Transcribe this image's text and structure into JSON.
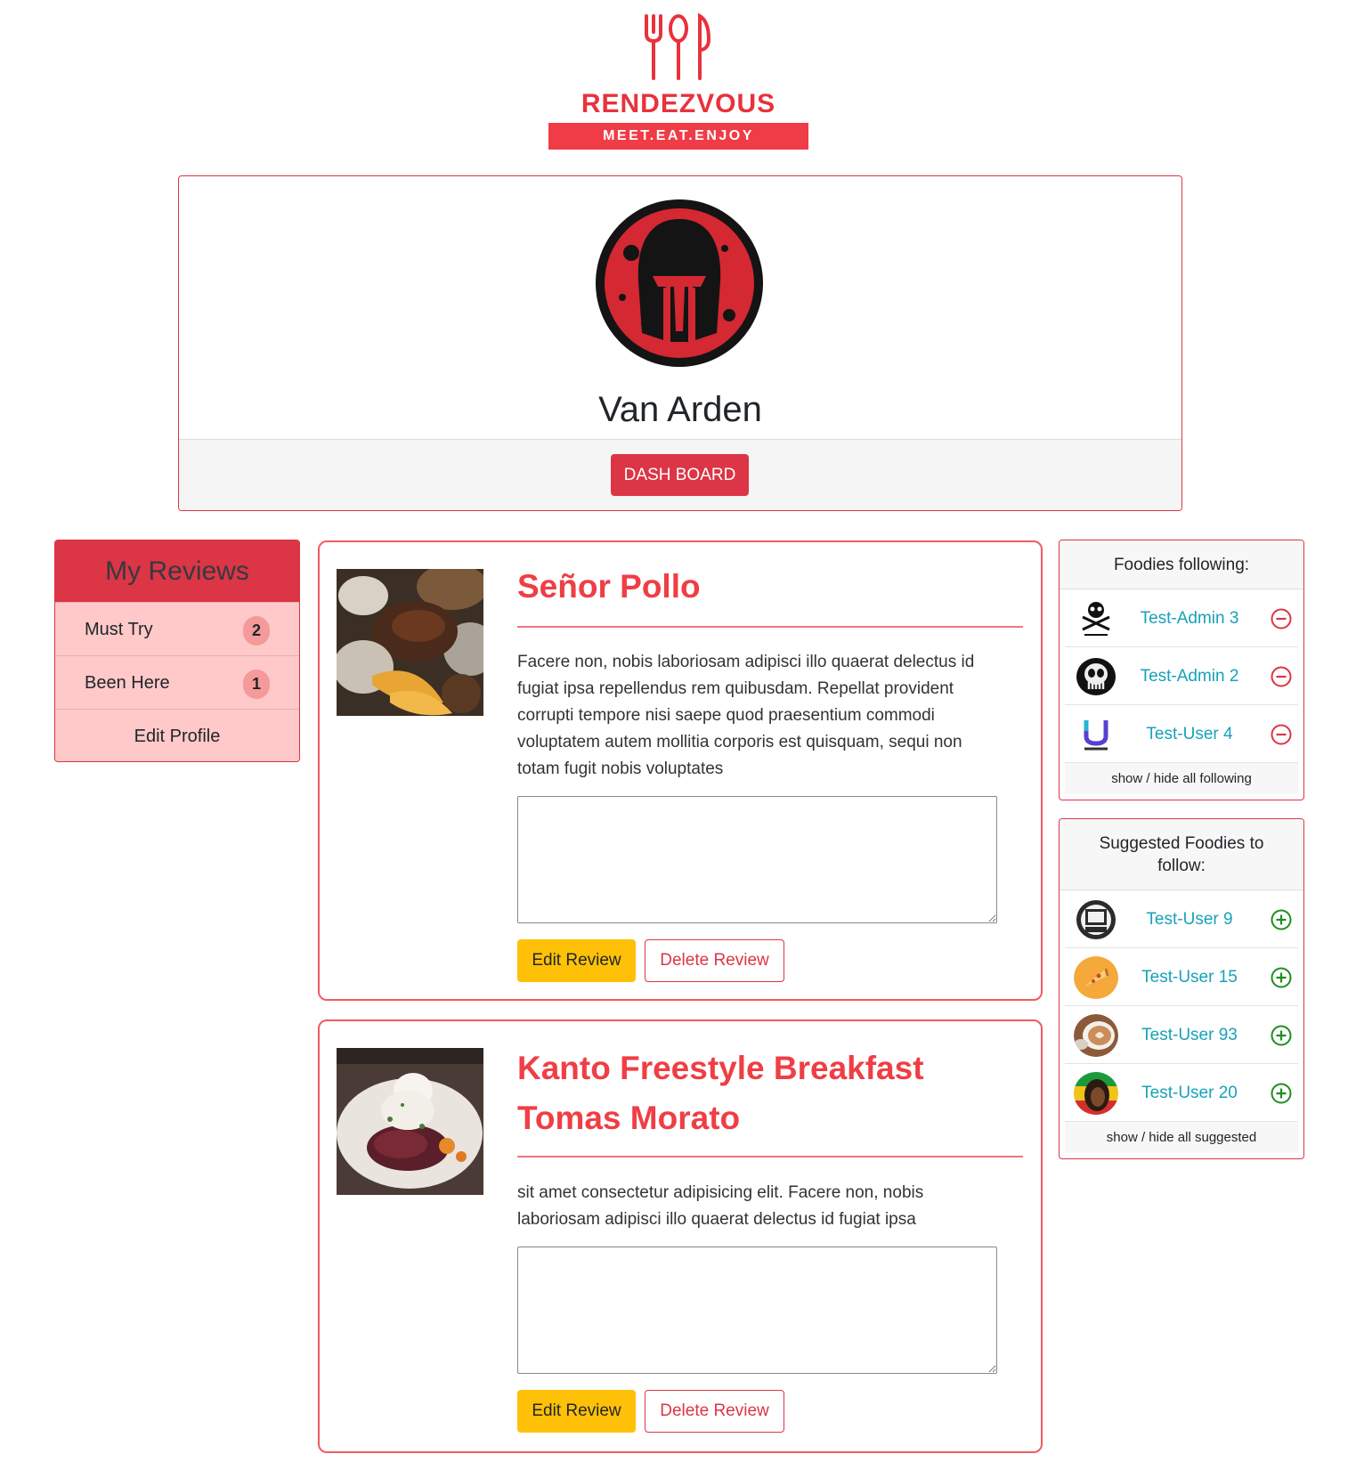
{
  "brand": {
    "name": "RENDEZVOUS",
    "tagline": "MEET.EAT.ENJOY",
    "accent": "#e8323c"
  },
  "profile": {
    "name": "Van Arden",
    "dashboard_button": "DASH BOARD",
    "avatar_icon": "spartan-helmet-icon"
  },
  "sidebar": {
    "title": "My Reviews",
    "items": [
      {
        "label": "Must Try",
        "count": "2"
      },
      {
        "label": "Been Here",
        "count": "1"
      },
      {
        "label": "Edit Profile"
      }
    ]
  },
  "reviews": [
    {
      "title": "Señor Pollo",
      "text": "Facere non, nobis laboriosam adipisci illo quaerat delectus id fugiat ipsa repellendus rem quibusdam. Repellat provident corrupti tempore nisi saepe quod praesentium commodi voluptatem autem mollitia corporis est quisquam, sequi non totam fugit nobis voluptates",
      "textarea_value": "",
      "edit_label": "Edit Review",
      "delete_label": "Delete Review",
      "image": "roast-chicken-platter-photo"
    },
    {
      "title": "Kanto Freestyle Breakfast Tomas Morato",
      "text": "sit amet consectetur adipisicing elit. Facere non, nobis laboriosam adipisci illo quaerat delectus id fugiat ipsa",
      "textarea_value": "",
      "edit_label": "Edit Review",
      "delete_label": "Delete Review",
      "image": "breakfast-plate-photo"
    }
  ],
  "following": {
    "title": "Foodies following:",
    "users": [
      {
        "name": "Test-Admin 3",
        "avatar": "skull-crossbones-avatar",
        "action": "unfollow-icon"
      },
      {
        "name": "Test-Admin 2",
        "avatar": "punisher-skull-avatar",
        "action": "unfollow-icon"
      },
      {
        "name": "Test-User 4",
        "avatar": "uplift-logo-avatar",
        "action": "unfollow-icon"
      }
    ],
    "toggle_label": "show / hide all following"
  },
  "suggested": {
    "title": "Suggested Foodies to follow:",
    "users": [
      {
        "name": "Test-User 9",
        "avatar": "k9-badge-avatar",
        "action": "follow-icon"
      },
      {
        "name": "Test-User 15",
        "avatar": "pizza-slice-avatar",
        "action": "follow-icon"
      },
      {
        "name": "Test-User 93",
        "avatar": "latte-cup-avatar",
        "action": "follow-icon"
      },
      {
        "name": "Test-User 20",
        "avatar": "rasta-portrait-avatar",
        "action": "follow-icon"
      }
    ],
    "toggle_label": "show / hide all suggested"
  },
  "colors": {
    "danger": "#dc3545",
    "warning": "#ffc107",
    "info": "#17a2b8",
    "success": "#1e8e1e",
    "sidebar_bg": "#ffc9c9"
  }
}
